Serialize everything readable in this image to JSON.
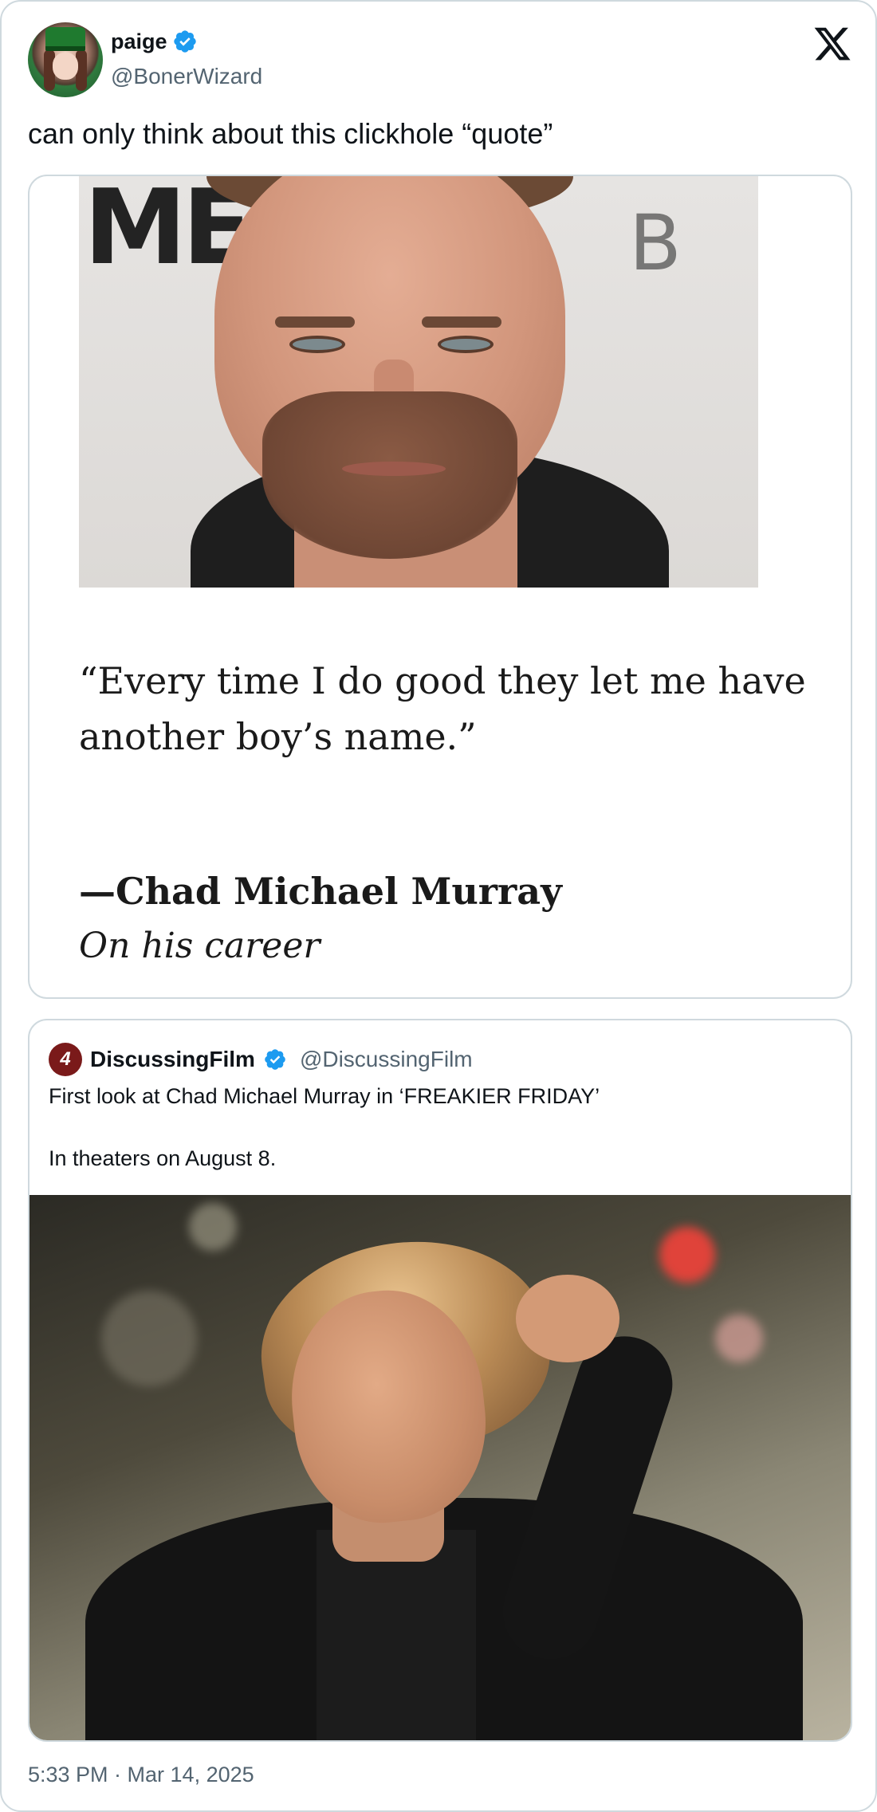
{
  "tweet": {
    "display_name": "paige",
    "handle": "@BonerWizard",
    "text": "can only think about this clickhole “quote”",
    "timestamp": "5:33 PM · Mar 14, 2025"
  },
  "quote_image": {
    "backdrop_letters": "ME",
    "backdrop_letter_right": "B",
    "quote": "“Every time I do good they let me have another boy’s name.”",
    "attribution": "—Chad Michael Murray",
    "attribution_sub": "On his career"
  },
  "quoted_tweet": {
    "avatar_letter": "4",
    "display_name": "DiscussingFilm",
    "handle": "@DiscussingFilm",
    "line1": "First look at Chad Michael Murray in ‘FREAKIER FRIDAY’",
    "line2": "In theaters on August 8."
  },
  "icons": {
    "verified": "verified-badge-icon",
    "platform": "x-logo-icon"
  },
  "colors": {
    "verified_blue": "#1d9bf0",
    "secondary_text": "#536471",
    "border": "#cfd9de"
  }
}
